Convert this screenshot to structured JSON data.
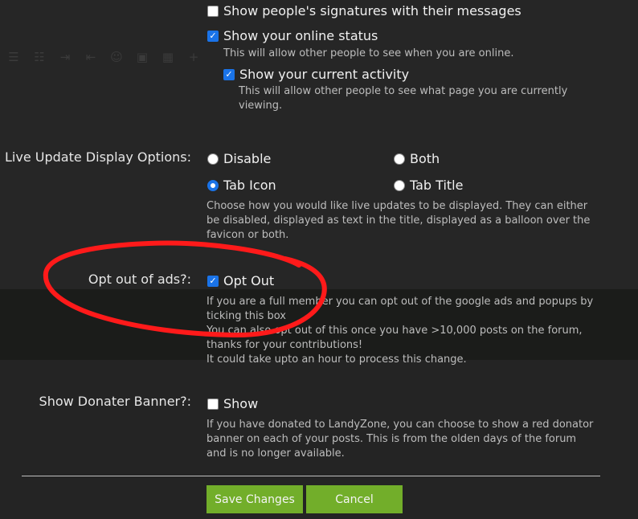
{
  "ghost_toolbar": [
    "list-bullet-icon",
    "list-number-icon",
    "indent-icon",
    "outdent-icon",
    "smiley-icon",
    "image-icon",
    "media-icon",
    "plus-icon"
  ],
  "signatures": {
    "label": "Show people's signatures with their messages",
    "checked": false
  },
  "online_status": {
    "label": "Show your online status",
    "checked": true,
    "hint": "This will allow other people to see when you are online."
  },
  "current_activity": {
    "label": "Show your current activity",
    "checked": true,
    "hint_lines": [
      "This will allow other people to see what page you are currently",
      "viewing."
    ]
  },
  "live_update": {
    "label": "Live Update Display Options:",
    "options": [
      {
        "label": "Disable",
        "selected": false
      },
      {
        "label": "Both",
        "selected": false
      },
      {
        "label": "Tab Icon",
        "selected": true
      },
      {
        "label": "Tab Title",
        "selected": false
      }
    ],
    "hint_lines": [
      "Choose how you would like live updates to be displayed. They can either",
      "be disabled, displayed as text in the title, displayed as a balloon over the",
      "favicon or both."
    ]
  },
  "opt_out_ads": {
    "label": "Opt out of ads?:",
    "option_label": "Opt Out",
    "checked": true,
    "hint_lines": [
      "If you are a full member you can opt out of the google ads and popups by",
      "ticking this box",
      "You can also opt out of this once you have >10,000 posts on the forum,",
      "thanks for your contributions!",
      "It could take upto an hour to process this change."
    ]
  },
  "donater_banner": {
    "label": "Show Donater Banner?:",
    "option_label": "Show",
    "checked": false,
    "hint_lines": [
      "If you have donated to LandyZone, you can choose to show a red donator",
      "banner on each of your posts. This is from the olden days of the forum",
      "and is no longer available."
    ]
  },
  "actions": {
    "save_label": "Save Changes",
    "cancel_label": "Cancel"
  },
  "colors": {
    "button": "#72ae2a",
    "checkbox": "#1a73e8",
    "annotation": "#ff1a1a"
  }
}
